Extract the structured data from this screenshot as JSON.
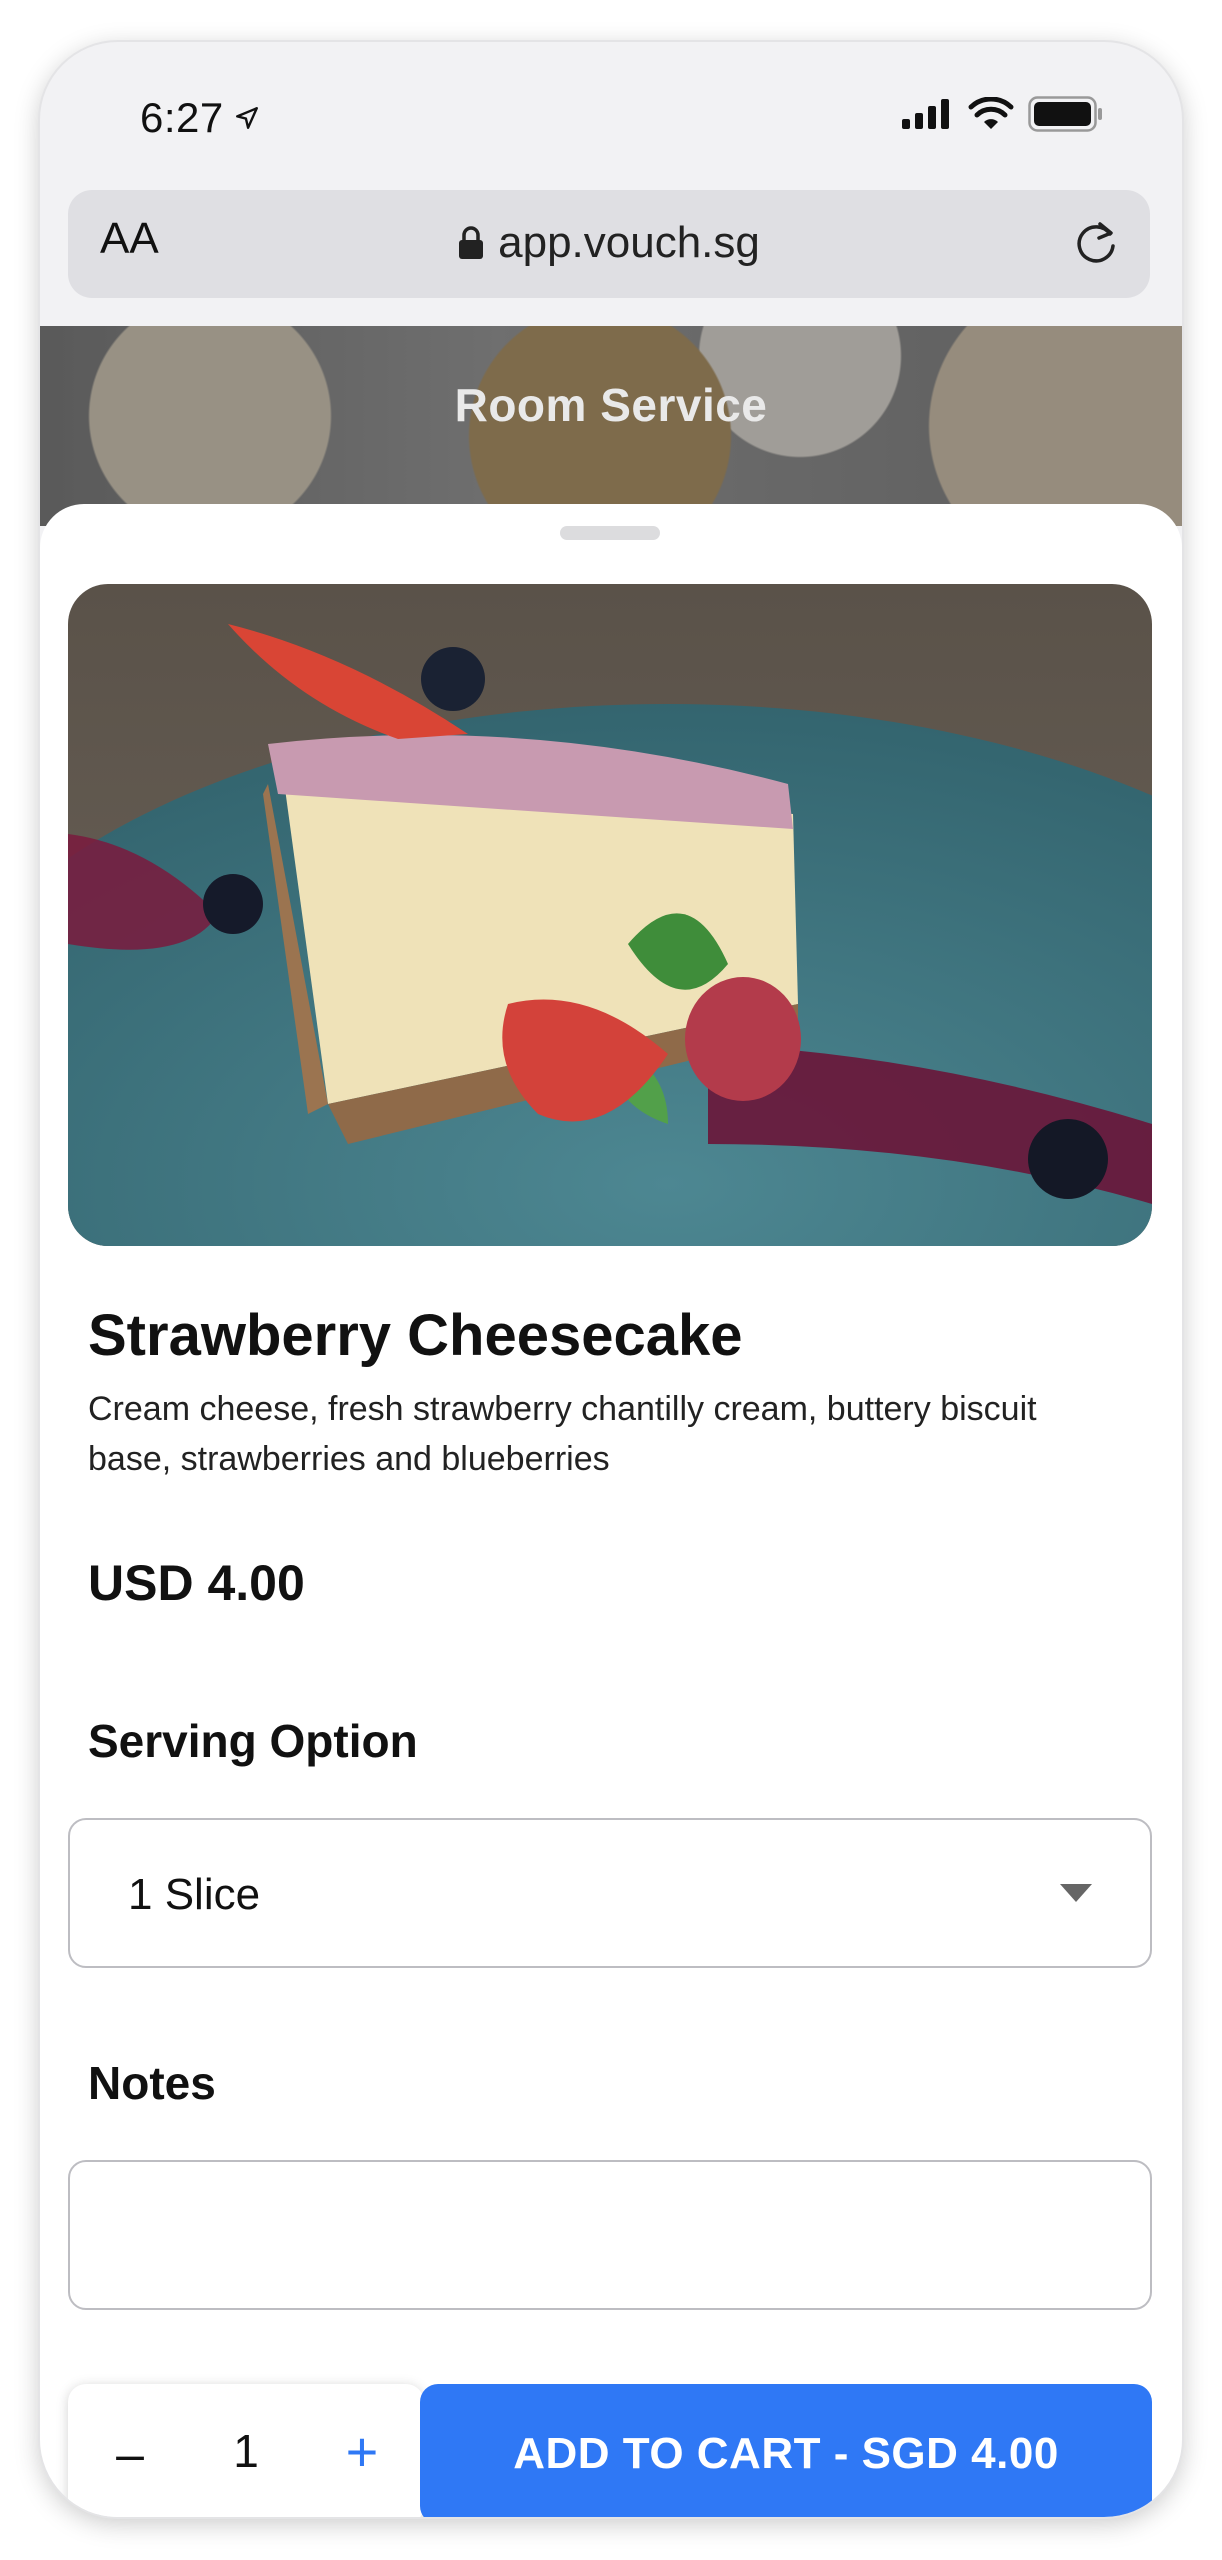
{
  "status_bar": {
    "time": "6:27"
  },
  "browser": {
    "text_size_label": "AA",
    "url": "app.vouch.sg"
  },
  "hero": {
    "title": "Room Service"
  },
  "product": {
    "name": "Strawberry Cheesecake",
    "description": "Cream cheese, fresh strawberry chantilly cream, buttery biscuit base, strawberries and blueberries",
    "price": "USD 4.00"
  },
  "serving": {
    "label": "Serving Option",
    "selected": "1 Slice"
  },
  "notes": {
    "label": "Notes",
    "value": ""
  },
  "cart": {
    "quantity": "1",
    "minus_label": "–",
    "plus_label": "+",
    "add_button_label": "ADD TO CART - SGD 4.00"
  },
  "colors": {
    "accent": "#2f78f5",
    "sheet": "#ffffff"
  },
  "icons": [
    "location-arrow-icon",
    "signal-icon",
    "wifi-icon",
    "battery-icon",
    "lock-icon",
    "reload-icon",
    "chevron-down-icon"
  ]
}
